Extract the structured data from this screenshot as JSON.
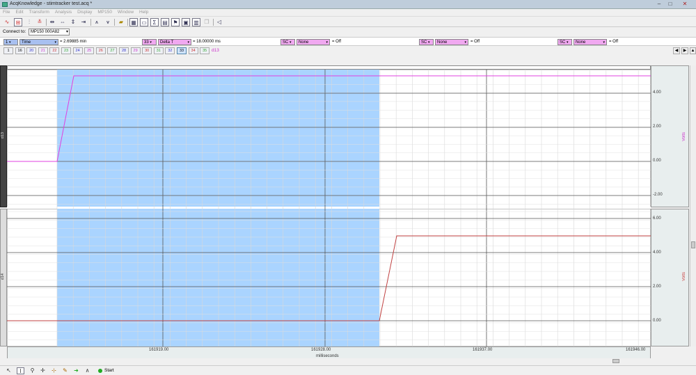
{
  "window": {
    "title": "AcqKnowledge - stimtracker test.acq *"
  },
  "menu": [
    "File",
    "Edit",
    "Transform",
    "Analysis",
    "Display",
    "MP150",
    "Window",
    "Help"
  ],
  "connect": {
    "label": "Connect to:",
    "device": "MP150 000A82"
  },
  "measurements": {
    "m1": {
      "channel": "1",
      "type": "Time",
      "value": "= 2.69885 min"
    },
    "m2": {
      "channel": "33",
      "type": "Delta T",
      "value": "= 18.00000 ms"
    },
    "m3": {
      "channel": "SC",
      "type": "None",
      "value": "= Off"
    },
    "m4": {
      "channel": "SC",
      "type": "None",
      "value": "= Off"
    },
    "m5": {
      "channel": "SC",
      "type": "None",
      "value": "= Off"
    }
  },
  "channels": [
    "1",
    "16",
    "20",
    "21",
    "22",
    "23",
    "24",
    "25",
    "26",
    "27",
    "28",
    "29",
    "30",
    "31",
    "32",
    "33",
    "34",
    "35"
  ],
  "active_channel_label": "d13",
  "graph": {
    "ch13": {
      "name": "d13",
      "unit": "Volts",
      "ticks": [
        "4.00",
        "2.00",
        "0.00",
        "-2.00"
      ]
    },
    "ch14": {
      "name": "d14",
      "unit": "Volts",
      "ticks": [
        "6.00",
        "4.00",
        "2.00",
        "0.00"
      ]
    },
    "x_ticks": [
      "161919.00",
      "161928.00",
      "161937.00",
      "161946.00"
    ],
    "x_label": "milliseconds",
    "colors": {
      "d13": "#e040e0",
      "d14": "#c04040",
      "selection": "#aad4ff"
    }
  },
  "status": {
    "start_label": "Start"
  }
}
